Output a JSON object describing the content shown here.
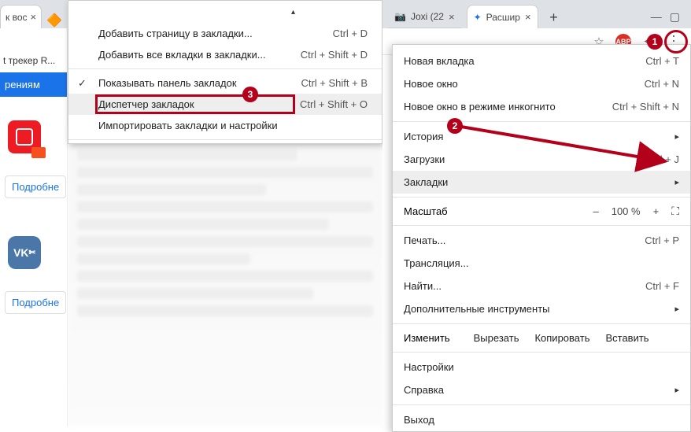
{
  "left": {
    "tab_fragment": "к вос",
    "tracker_text": "t трекер R...",
    "bluebar": "рениям",
    "details": "Подробне"
  },
  "submenu": {
    "items": [
      {
        "label": "Добавить страницу в закладки...",
        "shortcut": "Ctrl + D"
      },
      {
        "label": "Добавить все вкладки в закладки...",
        "shortcut": "Ctrl + Shift + D"
      }
    ],
    "show_panel": {
      "label": "Показывать панель закладок",
      "shortcut": "Ctrl + Shift + B"
    },
    "manager": {
      "label": "Диспетчер закладок",
      "shortcut": "Ctrl + Shift + O"
    },
    "import": {
      "label": "Импортировать закладки и настройки"
    }
  },
  "right": {
    "tabs": [
      {
        "label": "Joxi (22"
      },
      {
        "label": "Расшир"
      }
    ]
  },
  "menu": {
    "new_tab": {
      "label": "Новая вкладка",
      "shortcut": "Ctrl + T"
    },
    "new_window": {
      "label": "Новое окно",
      "shortcut": "Ctrl + N"
    },
    "incognito": {
      "label": "Новое окно в режиме инкогнито",
      "shortcut": "Ctrl + Shift + N"
    },
    "history": {
      "label": "История"
    },
    "downloads": {
      "label": "Загрузки",
      "shortcut": "Ctrl + J"
    },
    "bookmarks": {
      "label": "Закладки"
    },
    "zoom": {
      "label": "Масштаб",
      "minus": "–",
      "value": "100 %",
      "plus": "+"
    },
    "print": {
      "label": "Печать...",
      "shortcut": "Ctrl + P"
    },
    "cast": {
      "label": "Трансляция..."
    },
    "find": {
      "label": "Найти...",
      "shortcut": "Ctrl + F"
    },
    "more_tools": {
      "label": "Дополнительные инструменты"
    },
    "edit": {
      "label": "Изменить",
      "cut": "Вырезать",
      "copy": "Копировать",
      "paste": "Вставить"
    },
    "settings": {
      "label": "Настройки"
    },
    "help": {
      "label": "Справка"
    },
    "exit": {
      "label": "Выход"
    }
  },
  "badges": {
    "one": "1",
    "two": "2",
    "three": "3"
  },
  "icons": {
    "abp": "ABP",
    "vk": "VK"
  }
}
